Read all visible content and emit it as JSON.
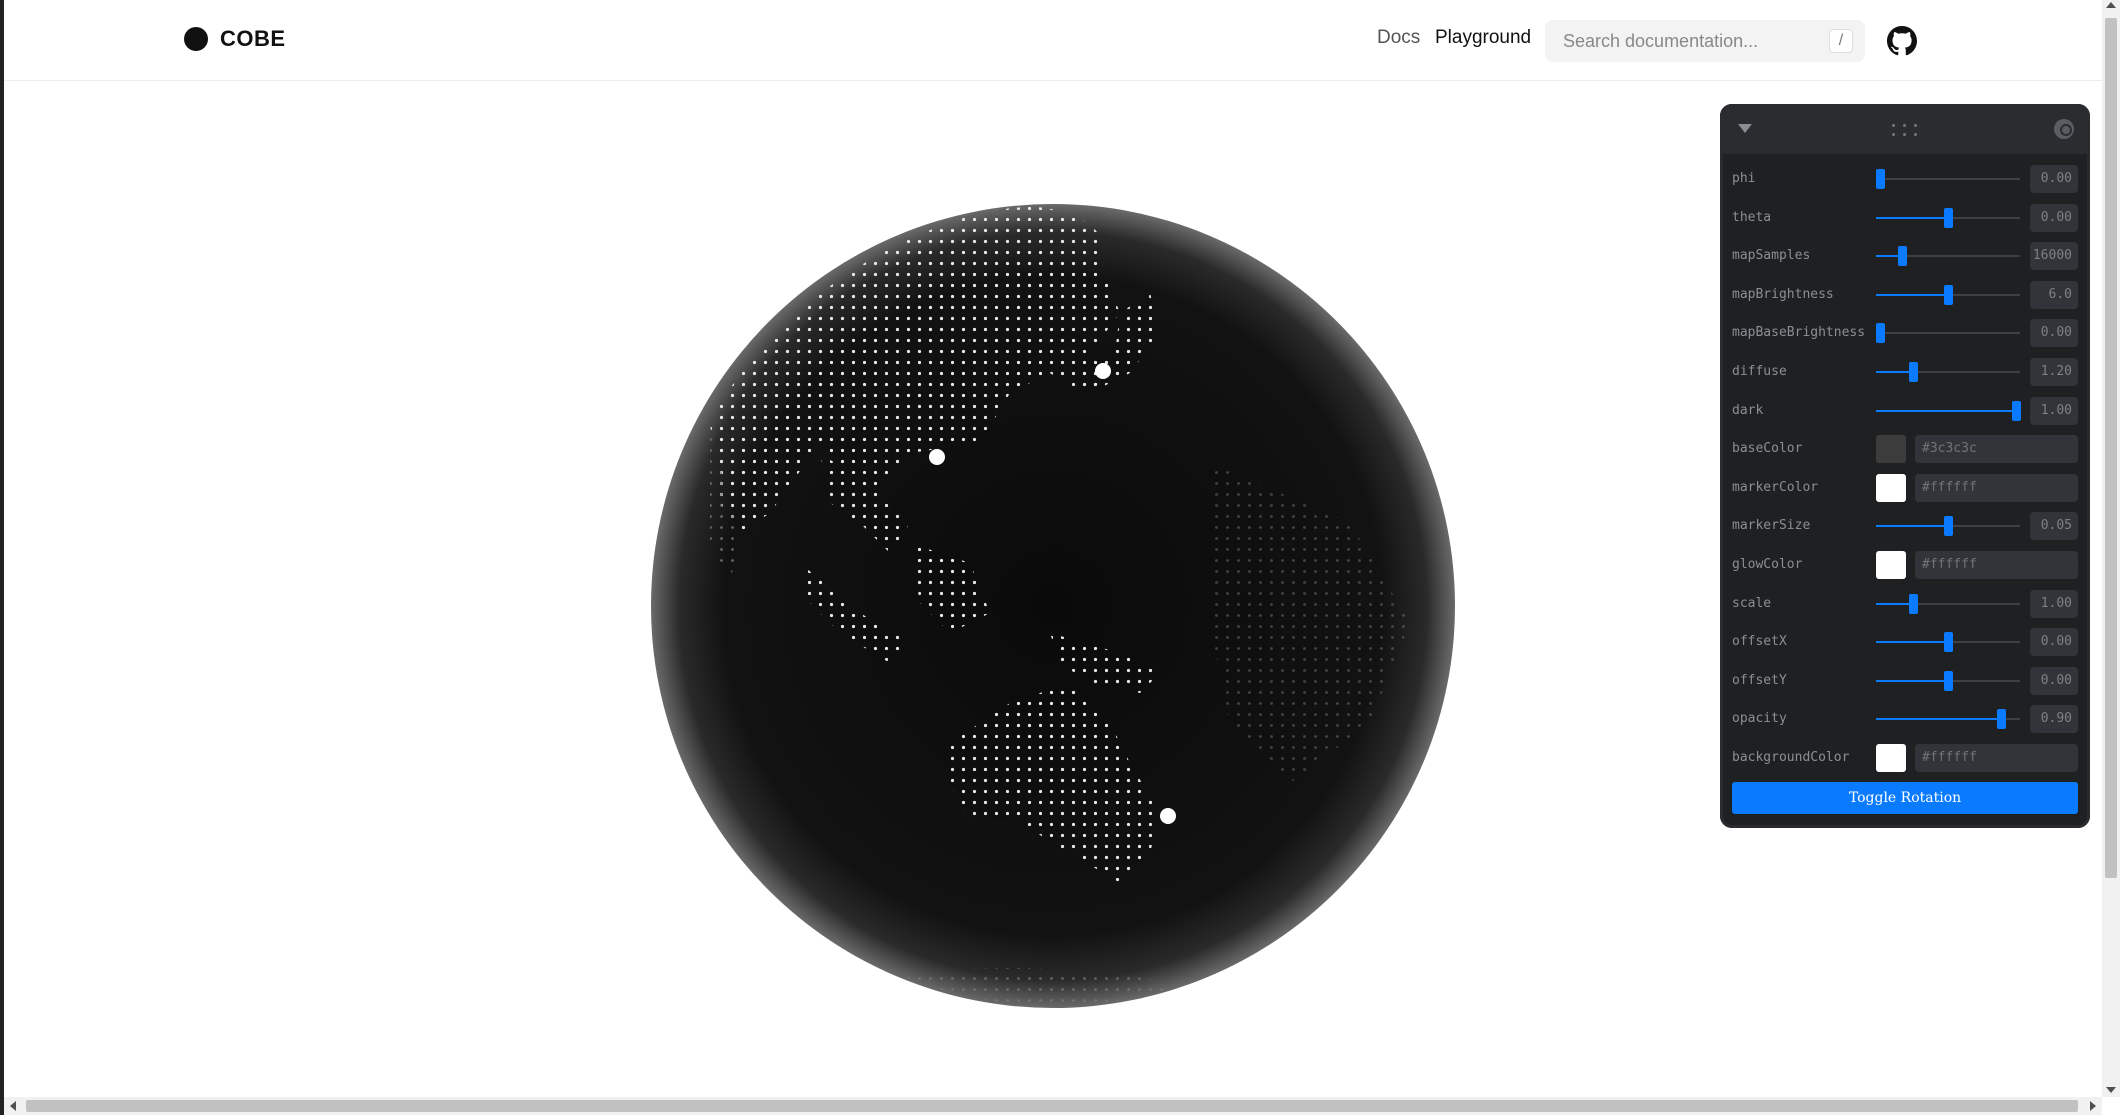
{
  "header": {
    "logo_text": "COBE",
    "nav": {
      "docs": "Docs",
      "playground": "Playground"
    },
    "search": {
      "placeholder": "Search documentation...",
      "shortcut": "/"
    }
  },
  "panel": {
    "controls": [
      {
        "label": "phi",
        "type": "slider",
        "value": "0.00",
        "fraction": 0.03
      },
      {
        "label": "theta",
        "type": "slider",
        "value": "0.00",
        "fraction": 0.5
      },
      {
        "label": "mapSamples",
        "type": "slider",
        "value": "16000",
        "fraction": 0.18
      },
      {
        "label": "mapBrightness",
        "type": "slider",
        "value": "6.0",
        "fraction": 0.5
      },
      {
        "label": "mapBaseBrightness",
        "type": "slider",
        "value": "0.00",
        "fraction": 0.03
      },
      {
        "label": "diffuse",
        "type": "slider",
        "value": "1.20",
        "fraction": 0.26
      },
      {
        "label": "dark",
        "type": "slider",
        "value": "1.00",
        "fraction": 0.97
      },
      {
        "label": "baseColor",
        "type": "color",
        "value": "#3c3c3c",
        "color": "#3c3c3c"
      },
      {
        "label": "markerColor",
        "type": "color",
        "value": "#ffffff",
        "color": "#ffffff"
      },
      {
        "label": "markerSize",
        "type": "slider",
        "value": "0.05",
        "fraction": 0.5
      },
      {
        "label": "glowColor",
        "type": "color",
        "value": "#ffffff",
        "color": "#ffffff"
      },
      {
        "label": "scale",
        "type": "slider",
        "value": "1.00",
        "fraction": 0.26
      },
      {
        "label": "offsetX",
        "type": "slider",
        "value": "0.00",
        "fraction": 0.5
      },
      {
        "label": "offsetY",
        "type": "slider",
        "value": "0.00",
        "fraction": 0.5
      },
      {
        "label": "opacity",
        "type": "slider",
        "value": "0.90",
        "fraction": 0.87
      },
      {
        "label": "backgroundColor",
        "type": "color",
        "value": "#ffffff",
        "color": "#ffffff"
      }
    ],
    "toggle_label": "Toggle Rotation"
  },
  "colors": {
    "accent": "#0a7bff",
    "panel_bg": "#1f2022",
    "globe": "#0c0c0c"
  },
  "icons": [
    "logo-dot-icon",
    "github-icon",
    "collapse-triangle-icon",
    "drag-grip-icon",
    "copy-icon"
  ]
}
